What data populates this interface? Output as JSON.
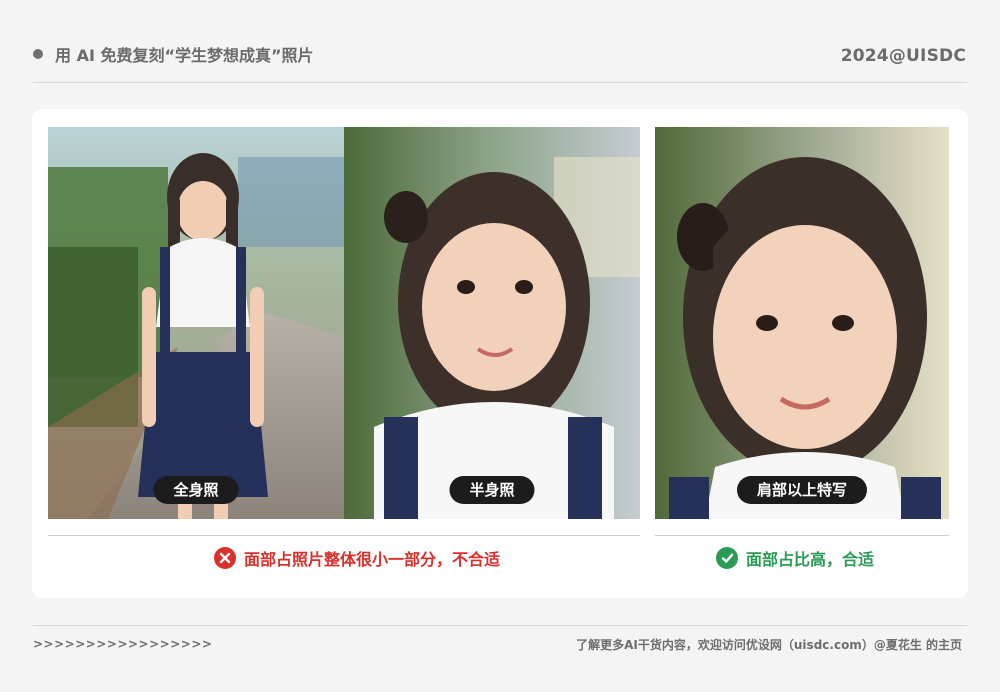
{
  "header": {
    "title": "用 AI 免费复刻“学生梦想成真”照片",
    "brand": "2024@UISDC"
  },
  "photos": [
    {
      "label": "全身照"
    },
    {
      "label": "半身照"
    },
    {
      "label": "肩部以上特写"
    }
  ],
  "verdicts": {
    "bad": {
      "text": "面部占照片整体很小一部分，不合适",
      "icon": "cross-icon",
      "color": "#d9302c"
    },
    "good": {
      "text": "面部占比高，合适",
      "icon": "check-icon",
      "color": "#2a9b55"
    }
  },
  "footer": {
    "left": ">>>>>>>>>>>>>>>>>",
    "right": "了解更多AI干货内容，欢迎访问优设网（uisdc.com）@夏花生 的主页"
  }
}
